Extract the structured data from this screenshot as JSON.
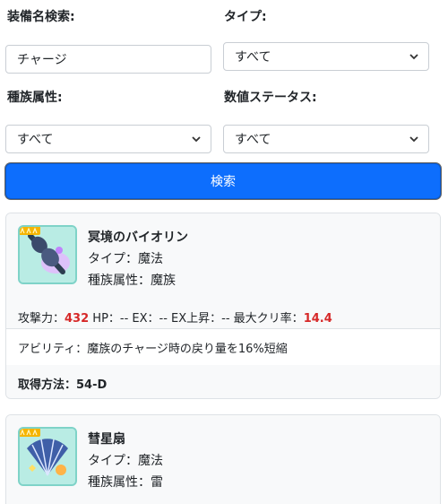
{
  "search_form": {
    "name_label": "装備名検索:",
    "name_value": "チャージ",
    "type_label": "タイプ:",
    "type_selected": "すべて",
    "tribe_label": "種族属性:",
    "tribe_selected": "すべて",
    "stat_label": "数値ステータス:",
    "stat_selected": "すべて",
    "search_button": "検索"
  },
  "results": [
    {
      "name": "冥境のバイオリン",
      "type_text": "タイプ：魔法",
      "tribe_text": "種族属性：魔族",
      "attack_label": "攻撃力：",
      "attack_value": "432",
      "middle_stats": " HP：-- EX：-- EX上昇：-- 最大クリ率：",
      "crit_value": "14.4",
      "ability": "アビリティ：魔族のチャージ時の戻り量を16%短縮",
      "acquisition": "取得方法：54-D"
    },
    {
      "name": "彗星扇",
      "type_text": "タイプ：魔法",
      "tribe_text": "種族属性：雷"
    }
  ],
  "colors": {
    "accent": "#0d6efd",
    "highlight_value": "#d62828"
  }
}
